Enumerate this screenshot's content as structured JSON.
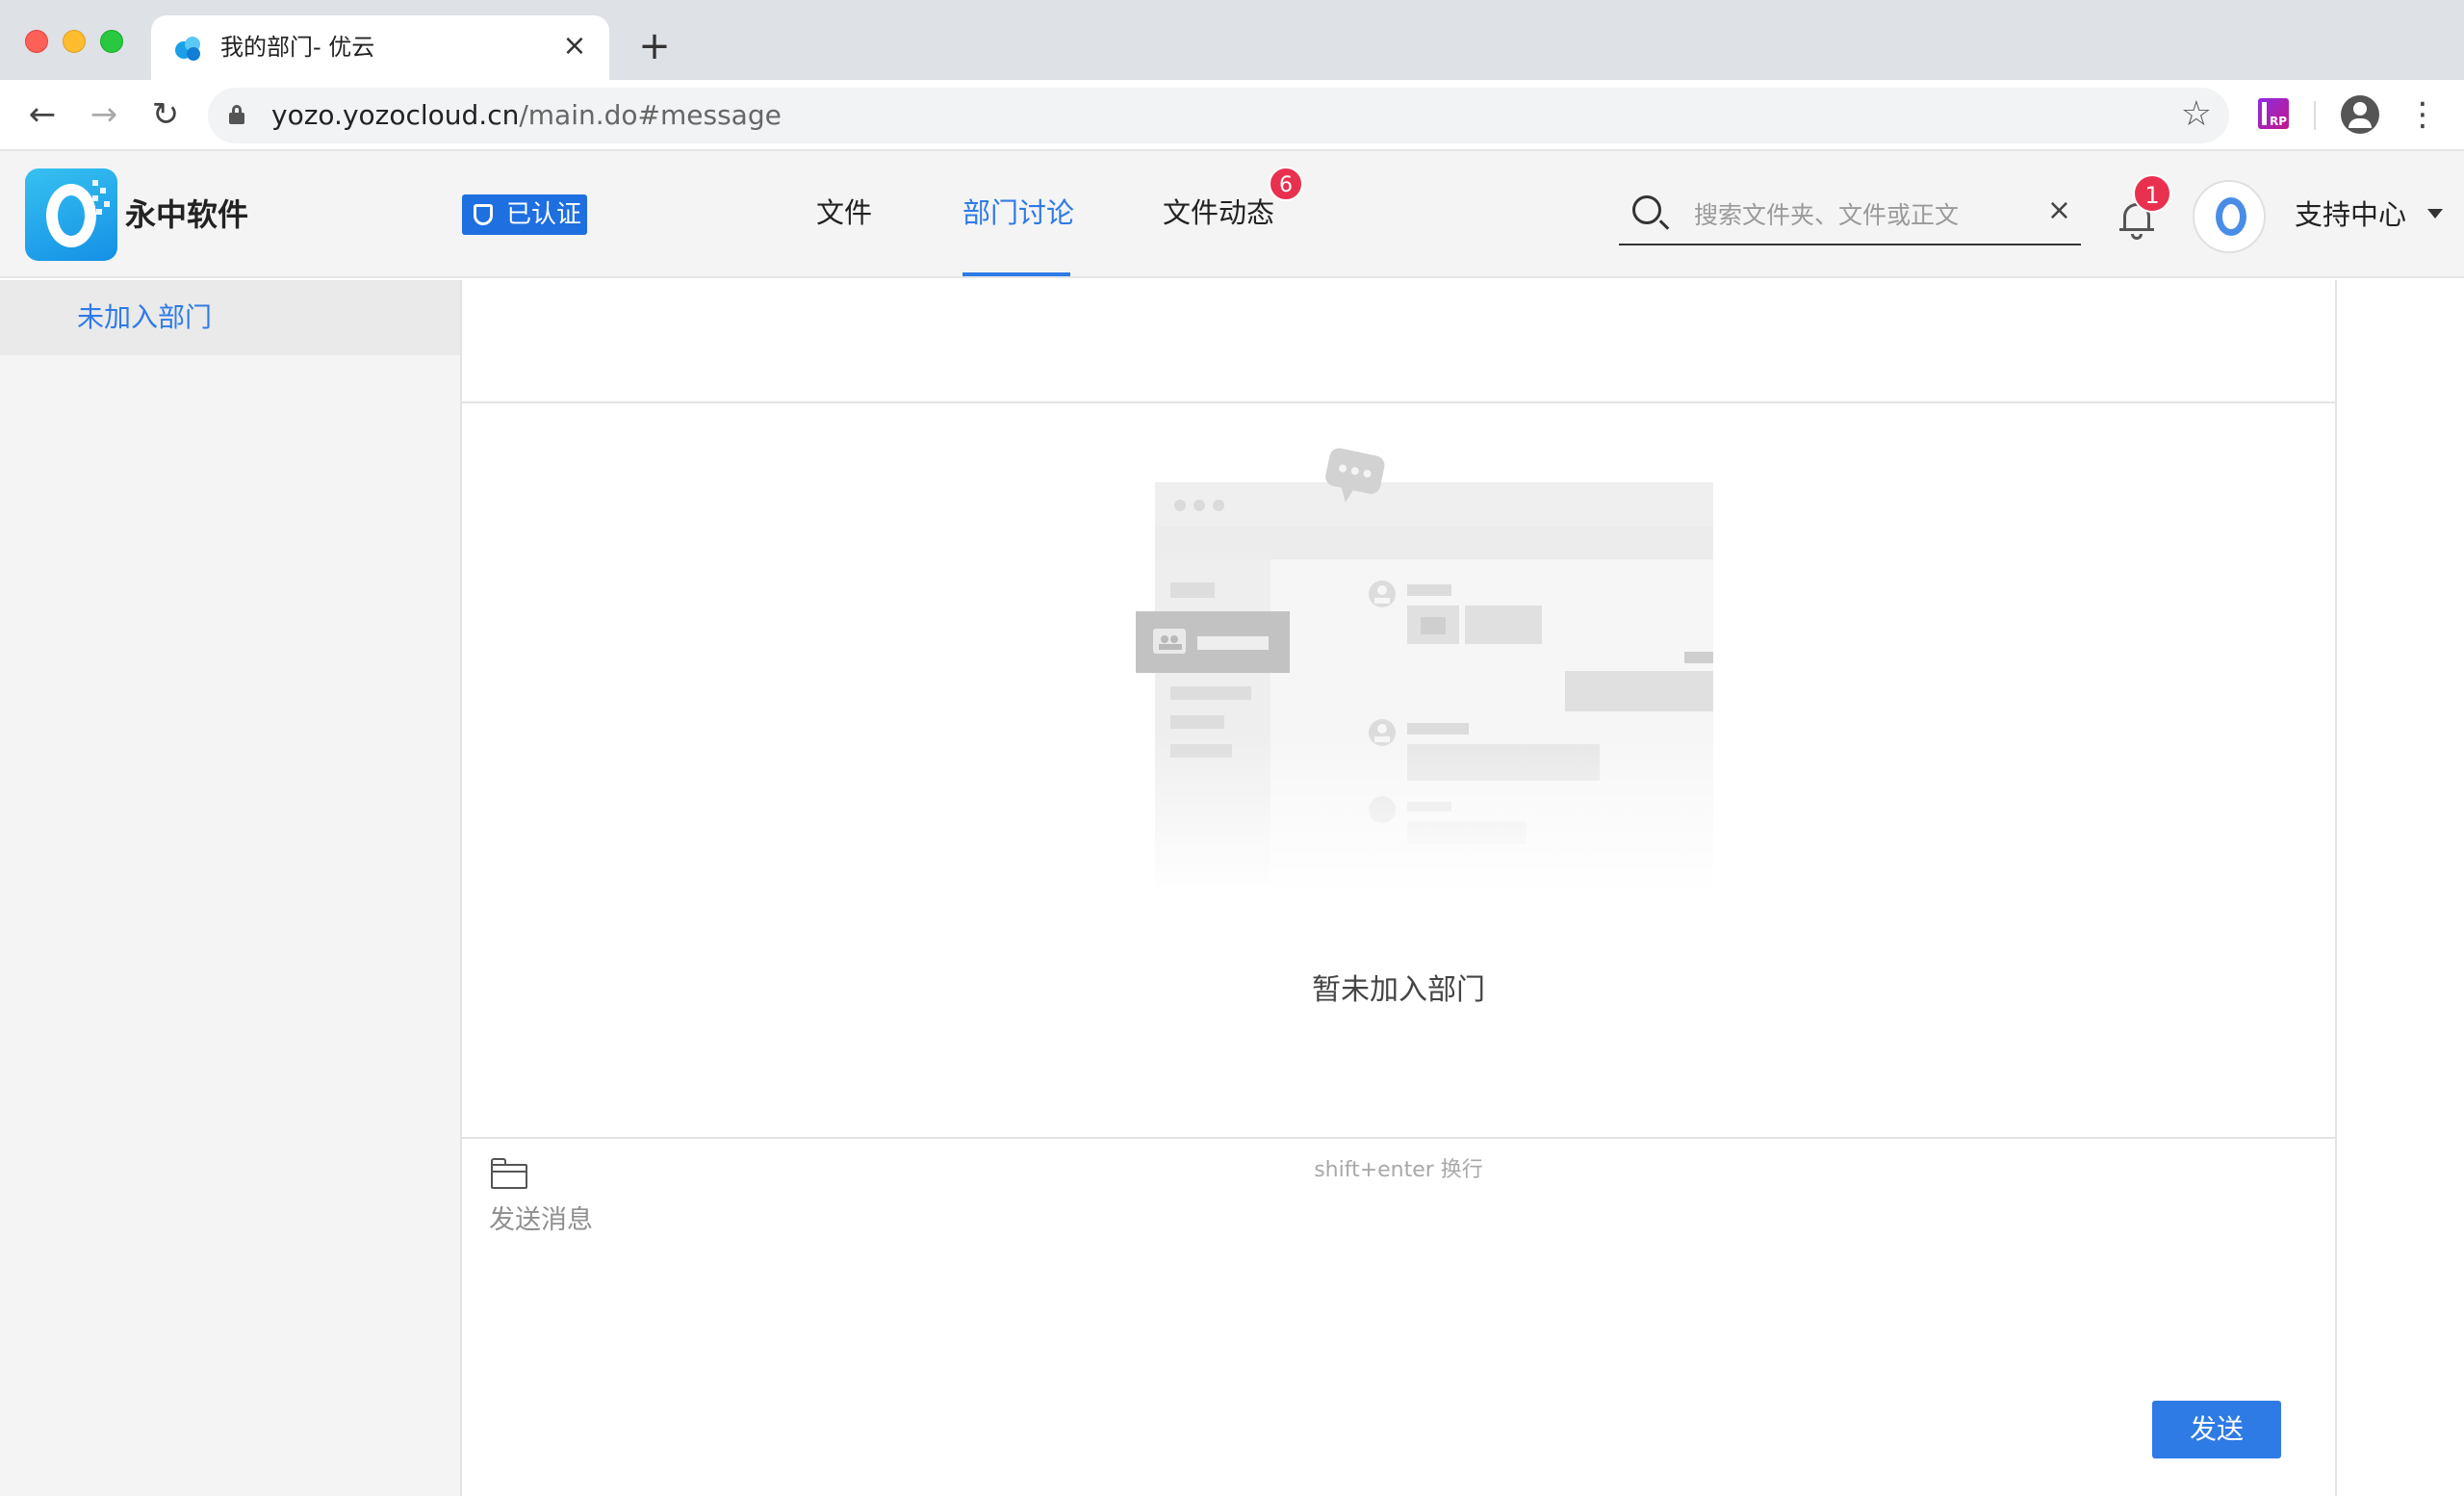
{
  "browser": {
    "tab_title": "我的部门- 优云",
    "close_glyph": "×",
    "new_tab_glyph": "+",
    "url_host": "yozo.yozocloud.cn",
    "url_path": "/main.do#message",
    "back_glyph": "←",
    "forward_glyph": "→",
    "reload_glyph": "↻",
    "bookmark_glyph": "☆",
    "menu_glyph": "⋮",
    "extension_label": "RP"
  },
  "header": {
    "brand_name": "永中软件",
    "verified_label": "已认证",
    "nav": [
      {
        "label": "文件"
      },
      {
        "label": "部门讨论",
        "active": true
      },
      {
        "label": "文件动态",
        "badge": "6"
      }
    ],
    "search_placeholder": "搜索文件夹、文件或正文",
    "search_clear_glyph": "×",
    "notification_badge": "1",
    "account_name": "支持中心"
  },
  "sidebar": {
    "items": [
      {
        "label": "未加入部门",
        "active": true
      }
    ]
  },
  "main": {
    "empty_text": "暂未加入部门"
  },
  "composer": {
    "hint": "shift+enter 换行",
    "placeholder": "发送消息",
    "send_label": "发送"
  },
  "colors": {
    "accent": "#2e7be6",
    "badge": "#e8314f",
    "verified_bg": "#1e6fe0"
  }
}
